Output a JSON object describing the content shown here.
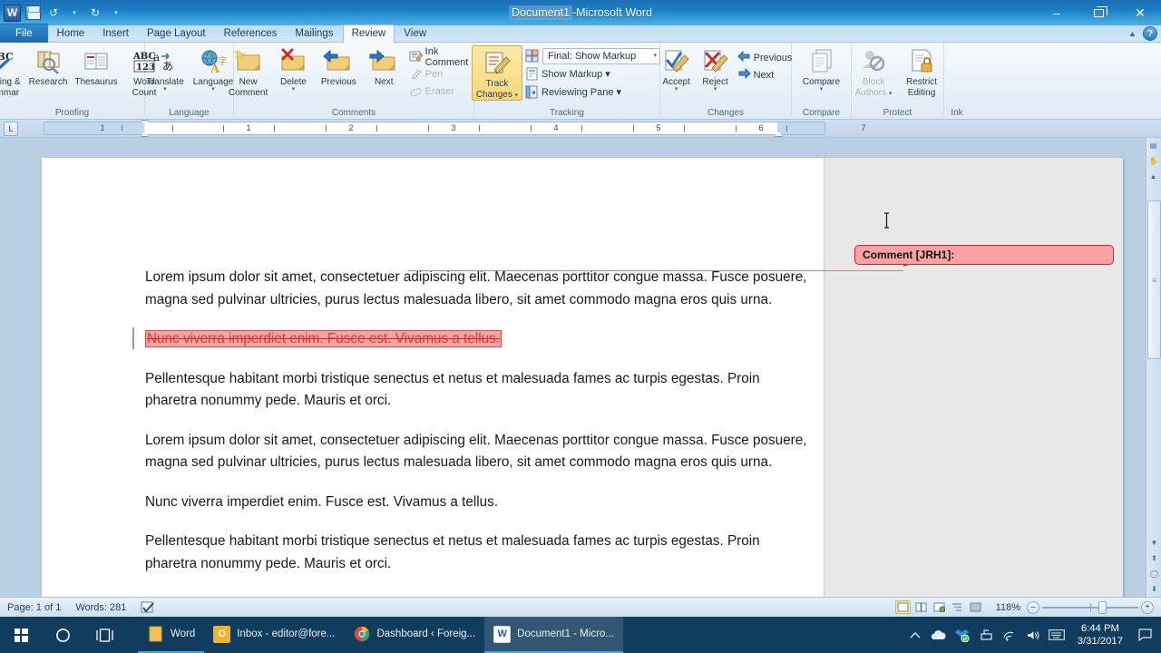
{
  "window": {
    "title_doc": "Document1",
    "title_sep": " - ",
    "title_app": "Microsoft Word",
    "minimize": "–",
    "restore": "restore-window",
    "close": "✕"
  },
  "quick_access": {
    "word_logo": "W",
    "save": "save-icon",
    "undo": "↺",
    "redo": "↻",
    "customize": "▾"
  },
  "tabs": [
    {
      "label": "File",
      "active": false
    },
    {
      "label": "Home",
      "active": false
    },
    {
      "label": "Insert",
      "active": false
    },
    {
      "label": "Page Layout",
      "active": false
    },
    {
      "label": "References",
      "active": false
    },
    {
      "label": "Mailings",
      "active": false
    },
    {
      "label": "Review",
      "active": true
    },
    {
      "label": "View",
      "active": false
    }
  ],
  "ribbon_tools": {
    "collapse": "▲",
    "help": "?"
  },
  "ribbon": {
    "groups": [
      {
        "name": "Proofing",
        "label": "Proofing",
        "buttons": [
          {
            "label": "Spelling &\nGrammar",
            "line1": "Spelling &",
            "line2": "Grammar",
            "icon": "spelling-grammar-icon",
            "disabled": false
          },
          {
            "label": "Research",
            "line1": "Research",
            "line2": "",
            "icon": "research-icon",
            "disabled": false
          },
          {
            "label": "Thesaurus",
            "line1": "Thesaurus",
            "line2": "",
            "icon": "thesaurus-icon",
            "disabled": false
          },
          {
            "label": "Word Count",
            "line1": "Word",
            "line2": "Count",
            "icon": "word-count-icon",
            "disabled": false
          }
        ]
      },
      {
        "name": "Language",
        "label": "Language",
        "buttons": [
          {
            "line1": "Translate",
            "line2": "",
            "icon": "translate-icon",
            "dropdown": true,
            "disabled": false
          },
          {
            "line1": "Language",
            "line2": "",
            "icon": "language-icon",
            "dropdown": true,
            "disabled": false
          }
        ]
      },
      {
        "name": "Comments",
        "label": "Comments",
        "buttons": [
          {
            "line1": "New",
            "line2": "Comment",
            "icon": "new-comment-icon",
            "disabled": false
          },
          {
            "line1": "Delete",
            "line2": "",
            "icon": "delete-comment-icon",
            "dropdown": true,
            "disabled": false
          },
          {
            "line1": "Previous",
            "line2": "",
            "icon": "previous-comment-icon",
            "disabled": false
          },
          {
            "line1": "Next",
            "line2": "",
            "icon": "next-comment-icon",
            "disabled": false
          }
        ],
        "small_buttons": [
          {
            "label": "Ink Comment",
            "icon": "ink-comment-icon",
            "disabled": false
          },
          {
            "label": "Pen",
            "icon": "pen-icon",
            "disabled": true
          },
          {
            "label": "Eraser",
            "icon": "eraser-icon",
            "disabled": true
          }
        ]
      },
      {
        "name": "Tracking",
        "label": "Tracking",
        "buttons": [
          {
            "line1": "Track",
            "line2": "Changes",
            "icon": "track-changes-icon",
            "dropdown": true,
            "active": true
          }
        ],
        "display_for_review": {
          "value": "Final: Show Markup",
          "caret": "▾",
          "icon": "display-review-icon"
        },
        "small_buttons": [
          {
            "label": "Show Markup ▾",
            "icon": "show-markup-icon",
            "disabled": false
          },
          {
            "label": "Reviewing Pane ▾",
            "icon": "reviewing-pane-icon",
            "disabled": false
          }
        ]
      },
      {
        "name": "Changes",
        "label": "Changes",
        "buttons": [
          {
            "line1": "Accept",
            "line2": "",
            "icon": "accept-change-icon",
            "dropdown": true,
            "disabled": false
          },
          {
            "line1": "Reject",
            "line2": "",
            "icon": "reject-change-icon",
            "dropdown": true,
            "disabled": false
          }
        ],
        "small_buttons": [
          {
            "label": "Previous",
            "icon": "previous-change-icon",
            "disabled": false
          },
          {
            "label": "Next",
            "icon": "next-change-icon",
            "disabled": false
          }
        ]
      },
      {
        "name": "Compare",
        "label": "Compare",
        "buttons": [
          {
            "line1": "Compare",
            "line2": "",
            "icon": "compare-icon",
            "dropdown": true,
            "disabled": false
          }
        ]
      },
      {
        "name": "Protect",
        "label": "Protect",
        "buttons": [
          {
            "line1": "Block",
            "line2": "Authors",
            "icon": "block-authors-icon",
            "dropdown": true,
            "disabled": true
          },
          {
            "line1": "Restrict",
            "line2": "Editing",
            "icon": "restrict-editing-icon",
            "disabled": false
          }
        ]
      },
      {
        "name": "Ink",
        "label": "Ink",
        "buttons": []
      }
    ]
  },
  "ruler": {
    "tab_stop_marker": "L",
    "numbers": [
      "1",
      "1",
      "2",
      "3",
      "4",
      "5",
      "6",
      "7"
    ]
  },
  "document": {
    "paragraphs": [
      "Lorem ipsum dolor sit amet, consectetuer adipiscing elit. Maecenas porttitor congue massa. Fusce posuere, magna sed pulvinar ultricies, purus lectus malesuada libero, sit amet commodo magna eros quis urna.",
      "Pellentesque habitant morbi tristique senectus et netus et malesuada fames ac turpis egestas. Proin pharetra nonummy pede. Mauris et orci.",
      "Lorem ipsum dolor sit amet, consectetuer adipiscing elit. Maecenas porttitor congue massa. Fusce posuere, magna sed pulvinar ultricies, purus lectus malesuada libero, sit amet commodo magna eros quis urna.",
      "Nunc viverra imperdiet enim. Fusce est. Vivamus a tellus.",
      "Pellentesque habitant morbi tristique senectus et netus et malesuada fames ac turpis egestas. Proin pharetra nonummy pede. Mauris et orci."
    ],
    "deleted_text": "Nunc viverra imperdiet enim. Fusce est. Vivamus a tellus.",
    "comment_balloon": "Comment [JRH1]:"
  },
  "status_bar": {
    "page": "Page: 1 of 1",
    "words": "Words: 281",
    "proofing_icon": "proofing-status-icon",
    "views": [
      {
        "name": "print-layout-view",
        "glyph": "▤",
        "selected": true
      },
      {
        "name": "full-screen-reading-view",
        "glyph": "▥",
        "selected": false
      },
      {
        "name": "web-layout-view",
        "glyph": "▦",
        "selected": false
      },
      {
        "name": "outline-view",
        "glyph": "▧",
        "selected": false
      },
      {
        "name": "draft-view",
        "glyph": "▨",
        "selected": false
      }
    ],
    "zoom_value": "118%",
    "zoom_out": "–",
    "zoom_in": "+"
  },
  "taskbar": {
    "start": "windows-start-icon",
    "cortana": "◯",
    "task_view": "task-view-icon",
    "items": [
      {
        "label": "Word",
        "icon": "word-taskbar-icon",
        "icon_letter": "",
        "color": "#e8bc46",
        "state": "pinned"
      },
      {
        "label": "Inbox - editor@fore...",
        "icon": "outlook-icon",
        "icon_letter": "O",
        "color": "#f3b229",
        "state": "open"
      },
      {
        "label": "Dashboard ‹ Foreig...",
        "icon": "chrome-icon",
        "icon_letter": "",
        "color": "#e8453c",
        "state": "open"
      },
      {
        "label": "Document1 - Micro...",
        "icon": "word-icon",
        "icon_letter": "W",
        "color": "#2b5797",
        "state": "active"
      }
    ],
    "tray": [
      {
        "name": "show-hidden-icons",
        "glyph": "⌃"
      },
      {
        "name": "onedrive-icon",
        "glyph": "☁"
      },
      {
        "name": "dropbox-icon",
        "glyph": "✤"
      },
      {
        "name": "usb-safely-remove-icon",
        "glyph": "⎙"
      },
      {
        "name": "network-icon",
        "glyph": "⌁"
      },
      {
        "name": "volume-icon",
        "glyph": "🔊"
      },
      {
        "name": "keyboard-icon",
        "glyph": "▤"
      }
    ],
    "time": "6:44 PM",
    "date": "3/31/2017",
    "action_center": "action-center-icon"
  },
  "colors": {
    "title_blue": "#1a7ec4",
    "ribbon_bg": "#eaf2f9",
    "accent_track_changes": "#f7d778",
    "markup_red": "#d02727",
    "balloon_fill": "#f9a3a3",
    "taskbar_bg": "#103c5e"
  }
}
